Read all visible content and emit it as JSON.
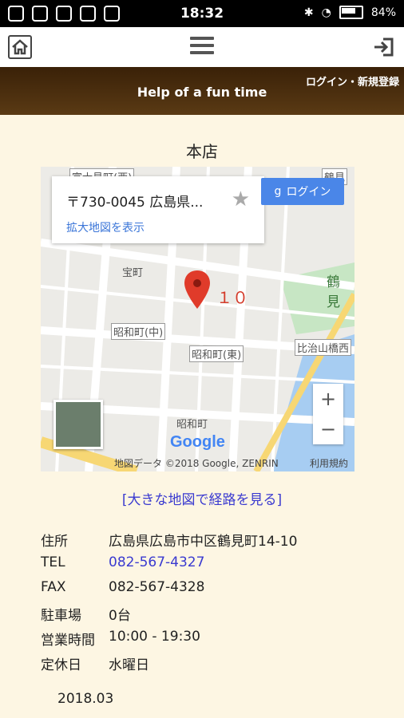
{
  "status_bar": {
    "time": "18:32",
    "battery": "84%"
  },
  "header": {
    "tagline": "Help of a fun time",
    "auth_link": "ログイン・新規登録"
  },
  "store": {
    "title": "本店"
  },
  "map": {
    "card_address": "〒730-0045 広島県...",
    "card_link": "拡大地図を表示",
    "google_login": "ログイン",
    "pin_label": "１０",
    "zoom_in": "+",
    "zoom_out": "−",
    "logo": "Google",
    "attribution": "地図データ ©2018 Google, ZENRIN",
    "terms": "利用規約",
    "labels": {
      "takara": "宝町",
      "showa_naka": "昭和町(中)",
      "showa_higashi": "昭和町(東)",
      "hijiyama": "比治山橋西",
      "showa": "昭和町",
      "tsurumi": "鶴見",
      "fujimi": "富士見町(西)",
      "tsuru": "鶴見"
    }
  },
  "route_link": "[大きな地図で経路を見る]",
  "info": [
    {
      "label": "住所",
      "value": "広島県広島市中区鶴見町14-10"
    },
    {
      "label": "TEL",
      "value": "082-567-4327"
    },
    {
      "label": "FAX",
      "value": "082-567-4328"
    },
    {
      "label": "駐車場",
      "value": "0台"
    },
    {
      "label": "営業時間",
      "value": "10:00 - 19:30"
    },
    {
      "label": "定休日",
      "value": "水曜日"
    }
  ],
  "updated": "2018.03"
}
